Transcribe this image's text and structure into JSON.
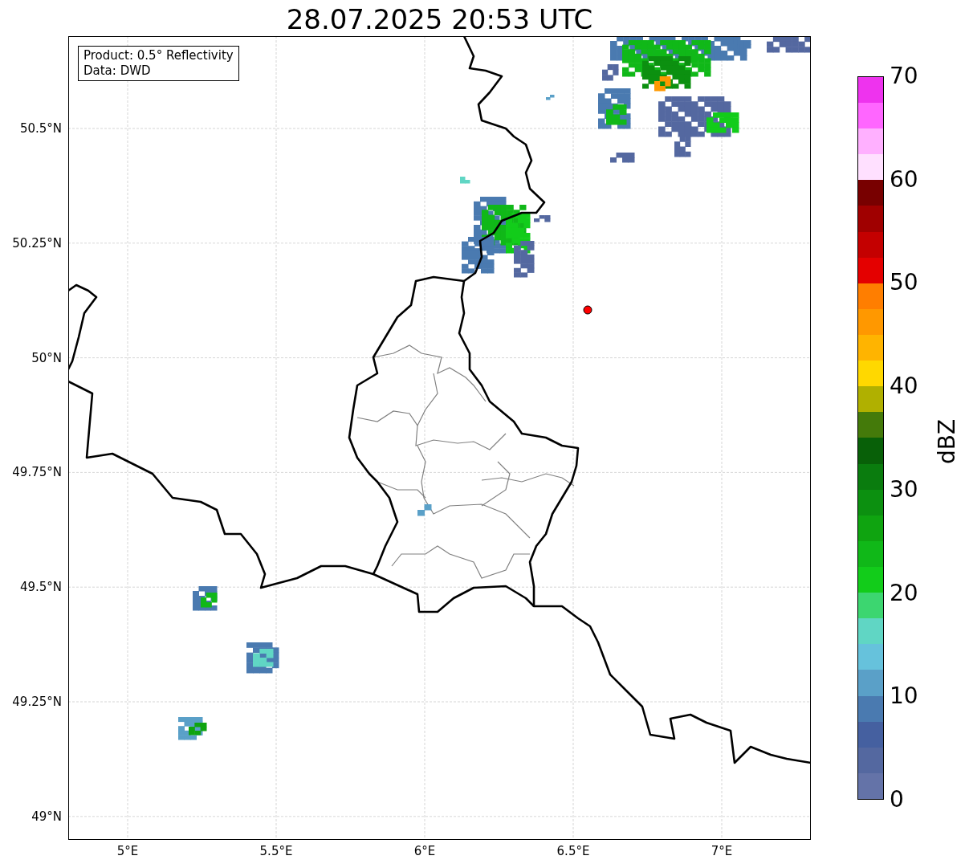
{
  "title": "28.07.2025 20:53 UTC",
  "legend": {
    "lines": [
      "Product: 0.5° Reflectivity",
      "Data: DWD"
    ]
  },
  "map": {
    "x_ticks": [
      "5°E",
      "5.5°E",
      "6°E",
      "6.5°E",
      "7°E"
    ],
    "y_ticks": [
      "50.5°N",
      "50.25°N",
      "50°N",
      "49.75°N",
      "49.5°N",
      "49.25°N",
      "49°N"
    ]
  },
  "colorbar": {
    "label": "dBZ",
    "ticks": [
      "70",
      "60",
      "50",
      "40",
      "30",
      "20",
      "10",
      "0"
    ],
    "bins": [
      {
        "color": "#6473a8"
      },
      {
        "color": "#5468a0"
      },
      {
        "color": "#4560a0"
      },
      {
        "color": "#4a7ab0"
      },
      {
        "color": "#5aa0c8"
      },
      {
        "color": "#66c2dc"
      },
      {
        "color": "#60d6c4"
      },
      {
        "color": "#3cd670"
      },
      {
        "color": "#12cc1a"
      },
      {
        "color": "#10b818"
      },
      {
        "color": "#0fa410"
      },
      {
        "color": "#0c9010"
      },
      {
        "color": "#0a7c0e"
      },
      {
        "color": "#086008"
      },
      {
        "color": "#447a0a"
      },
      {
        "color": "#b0b000"
      },
      {
        "color": "#ffd800"
      },
      {
        "color": "#ffb400"
      },
      {
        "color": "#ff9800"
      },
      {
        "color": "#ff7e00"
      },
      {
        "color": "#e40000"
      },
      {
        "color": "#c40000"
      },
      {
        "color": "#a00000"
      },
      {
        "color": "#780000"
      },
      {
        "color": "#ffe0ff"
      },
      {
        "color": "#ffb0ff"
      },
      {
        "color": "#ff66ff"
      },
      {
        "color": "#ee33ee"
      }
    ]
  }
}
